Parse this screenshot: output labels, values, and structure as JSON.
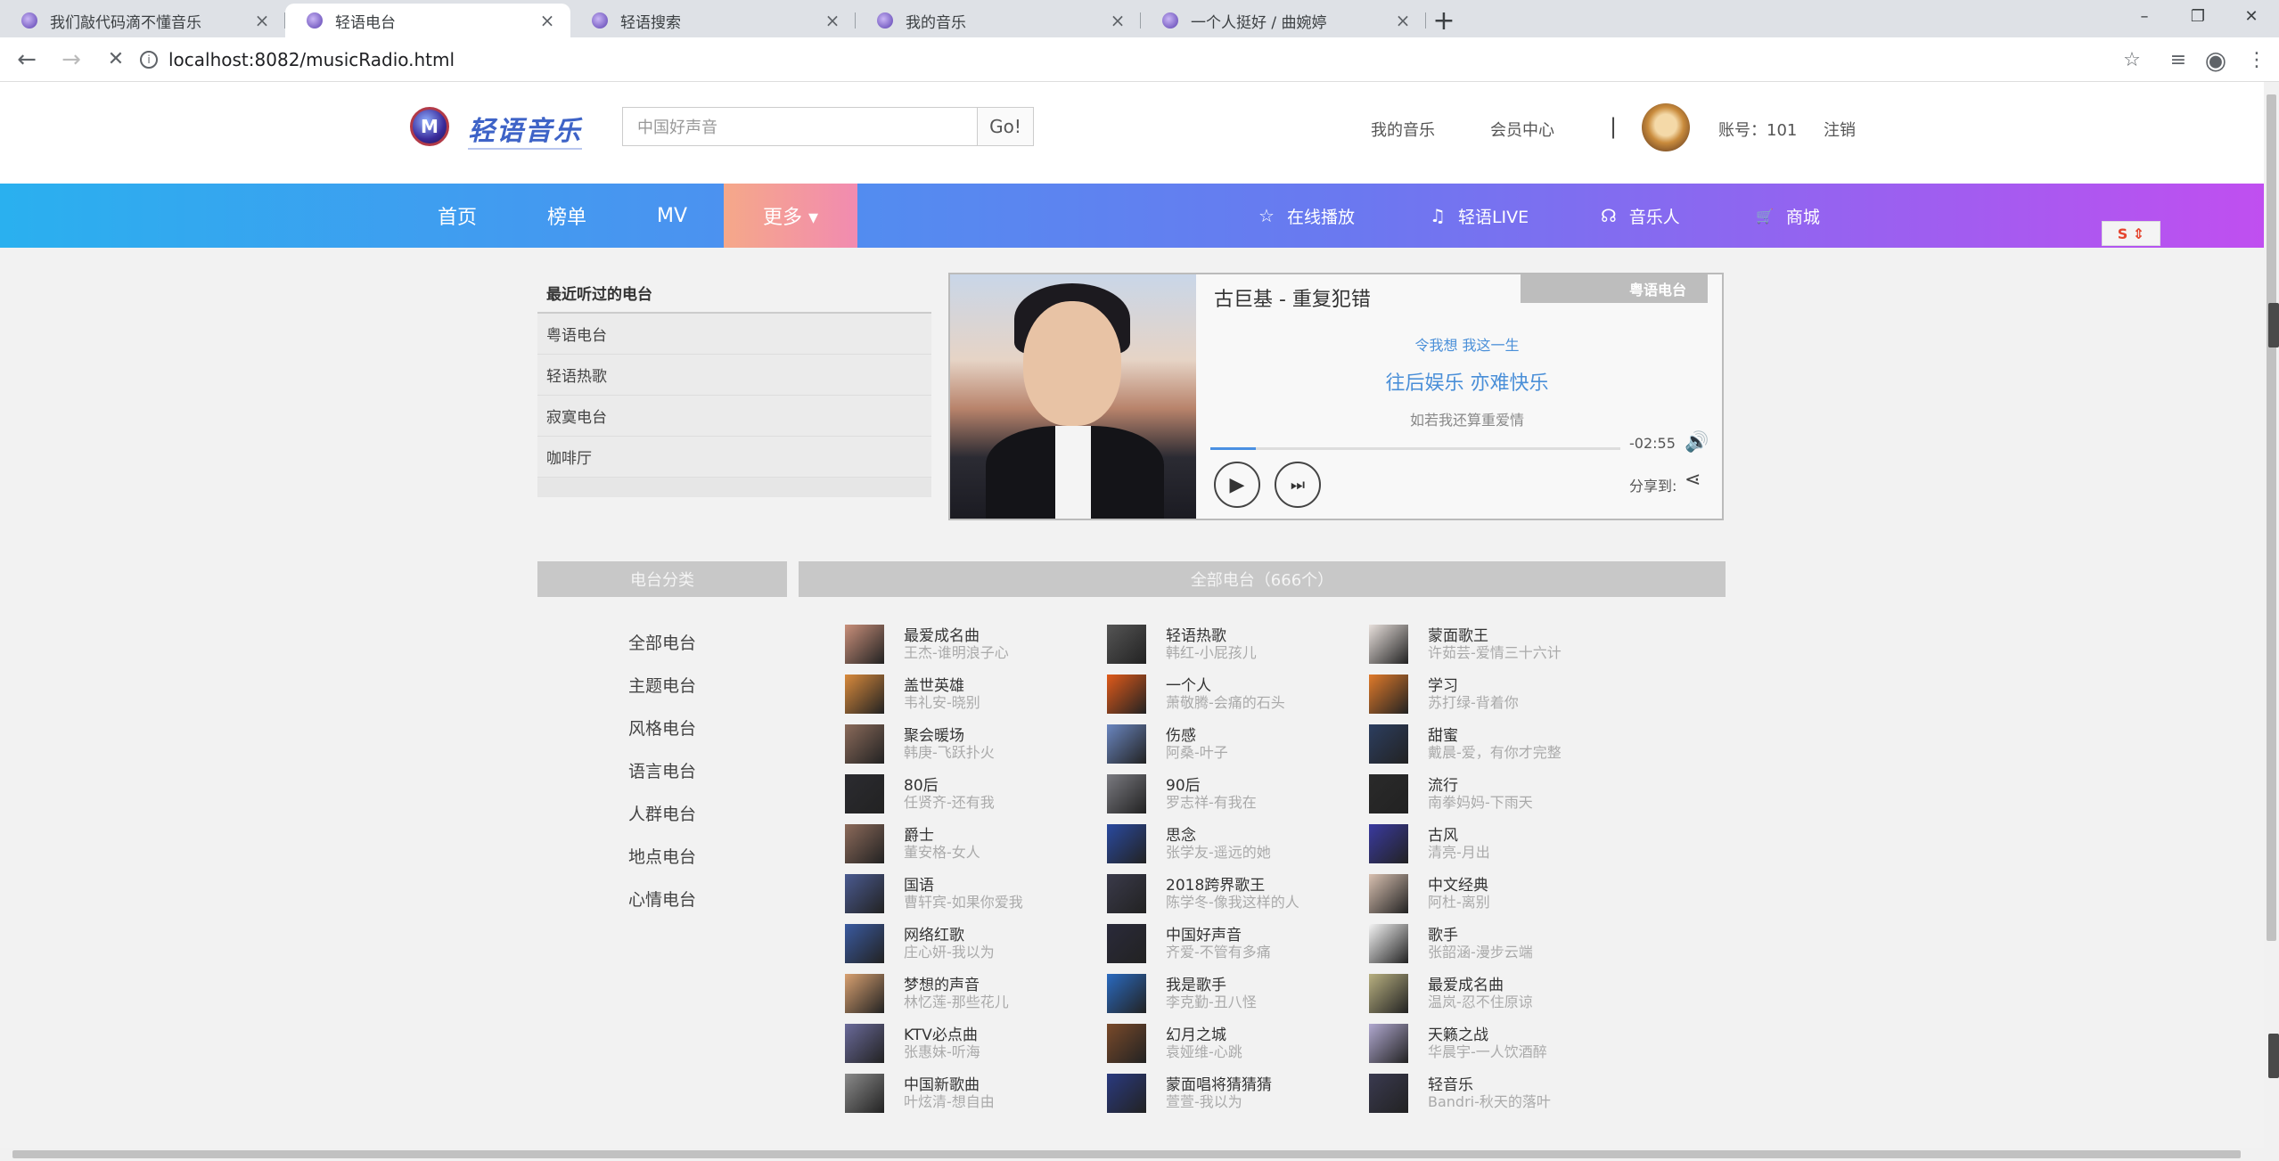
{
  "browser": {
    "tabs": [
      {
        "title": "我们敲代码滴不懂音乐",
        "active": false
      },
      {
        "title": "轻语电台",
        "active": true
      },
      {
        "title": "轻语搜索",
        "active": false
      },
      {
        "title": "我的音乐",
        "active": false
      },
      {
        "title": "一个人挺好 / 曲婉婷",
        "active": false
      }
    ],
    "close_glyph": "×",
    "new_tab_glyph": "+",
    "url": "localhost:8082/musicRadio.html",
    "back_glyph": "←",
    "forward_glyph": "→",
    "reload_glyph": "✕",
    "star_glyph": "☆",
    "minimize_glyph": "–",
    "restore_glyph": "❐",
    "close_window_glyph": "✕",
    "menu_glyph": "⋮",
    "info_glyph": "i",
    "profile_glyph": "◉",
    "queue_glyph": "≡"
  },
  "header": {
    "logo_mark": "M",
    "logo_text": "轻语音乐",
    "search_placeholder": "中国好声音",
    "go_label": "Go!",
    "links": {
      "my_music": "我的音乐",
      "member": "会员中心",
      "sep": "|",
      "account": "账号：101",
      "logout": "注销"
    }
  },
  "nav": {
    "items": [
      "首页",
      "榜单",
      "MV"
    ],
    "more": "更多 ▾",
    "right": [
      {
        "icon": "star-icon",
        "glyph": "☆",
        "label": "在线播放"
      },
      {
        "icon": "music-note-icon",
        "glyph": "♫",
        "label": "轻语LIVE"
      },
      {
        "icon": "headphones-icon",
        "glyph": "☊",
        "label": "音乐人"
      },
      {
        "icon": "cart-icon",
        "glyph": "🛒",
        "label": "商城"
      }
    ],
    "ime": "S ⇕"
  },
  "recent": {
    "title": "最近听过的电台",
    "items": [
      "粤语电台",
      "轻语热歌",
      "寂寞电台",
      "咖啡厅"
    ]
  },
  "player": {
    "song": "古巨基 - 重复犯错",
    "station": "粤语电台",
    "lyrics": [
      "令我想  我这一生",
      "往后娱乐  亦难快乐",
      "如若我还算重爱情"
    ],
    "time": "-02:55",
    "progress": 0.11,
    "play_glyph": "▶",
    "next_glyph": "⏭",
    "volume_glyph": "🔊",
    "share_label": "分享到:",
    "share_glyph": "⋖"
  },
  "categories": {
    "title": "电台分类",
    "items": [
      "全部电台",
      "主题电台",
      "风格电台",
      "语言电台",
      "人群电台",
      "地点电台",
      "心情电台"
    ]
  },
  "stations": {
    "title": "全部电台（666个）",
    "items": [
      {
        "name": "最爱成名曲",
        "sub": "王杰-谁明浪子心",
        "color": "#c98f7a"
      },
      {
        "name": "轻语热歌",
        "sub": "韩红-小屁孩儿",
        "color": "#555"
      },
      {
        "name": "蒙面歌王",
        "sub": "许茹芸-爱情三十六计",
        "color": "#e8e0dc"
      },
      {
        "name": "盖世英雄",
        "sub": "韦礼安-晓别",
        "color": "#d98a3c"
      },
      {
        "name": "一个人",
        "sub": "萧敬腾-会痛的石头",
        "color": "#e05a1a"
      },
      {
        "name": "学习",
        "sub": "苏打绿-背着你",
        "color": "#e07a2a"
      },
      {
        "name": "聚会暖场",
        "sub": "韩庚-飞跃扑火",
        "color": "#8a6a5a"
      },
      {
        "name": "伤感",
        "sub": "阿桑-叶子",
        "color": "#6a86c0"
      },
      {
        "name": "甜蜜",
        "sub": "戴晨-爱，有你才完整",
        "color": "#2c3e60"
      },
      {
        "name": "80后",
        "sub": "任贤齐-还有我",
        "color": "#2b2b30"
      },
      {
        "name": "90后",
        "sub": "罗志祥-有我在",
        "color": "#7a7a80"
      },
      {
        "name": "流行",
        "sub": "南拳妈妈-下雨天",
        "color": "#2a2a2a"
      },
      {
        "name": "爵士",
        "sub": "董安格-女人",
        "color": "#8c6a5a"
      },
      {
        "name": "思念",
        "sub": "张学友-遥远的她",
        "color": "#2a4aa0"
      },
      {
        "name": "古风",
        "sub": "清亮-月出",
        "color": "#3a3aa0"
      },
      {
        "name": "国语",
        "sub": "曹轩宾-如果你爱我",
        "color": "#4a5a90"
      },
      {
        "name": "2018跨界歌王",
        "sub": "陈学冬-像我这样的人",
        "color": "#3a3a4a"
      },
      {
        "name": "中文经典",
        "sub": "阿杜-离别",
        "color": "#d8c0b0"
      },
      {
        "name": "网络红歌",
        "sub": "庄心妍-我以为",
        "color": "#3a5aa0"
      },
      {
        "name": "中国好声音",
        "sub": "齐爱-不管有多痛",
        "color": "#2a2a3a"
      },
      {
        "name": "歌手",
        "sub": "张韶涵-漫步云端",
        "color": "#f4f4f4"
      },
      {
        "name": "梦想的声音",
        "sub": "林忆莲-那些花儿",
        "color": "#d8a070"
      },
      {
        "name": "我是歌手",
        "sub": "李克勤-丑八怪",
        "color": "#2a6ac0"
      },
      {
        "name": "最爱成名曲",
        "sub": "温岚-忍不住原谅",
        "color": "#b8b080"
      },
      {
        "name": "KTV必点曲",
        "sub": "张惠妹-听海",
        "color": "#6a6a9a"
      },
      {
        "name": "幻月之城",
        "sub": "袁娅维-心跳",
        "color": "#7a4a2a"
      },
      {
        "name": "天籁之战",
        "sub": "华晨宇-一人饮酒醉",
        "color": "#b0a8d0"
      },
      {
        "name": "中国新歌曲",
        "sub": "叶炫清-想自由",
        "color": "#8a8a8a"
      },
      {
        "name": "蒙面唱将猜猜猜",
        "sub": "萱萱-我以为",
        "color": "#2a3a80"
      },
      {
        "name": "轻音乐",
        "sub": "Bandri-秋天的落叶",
        "color": "#3a3a50"
      }
    ]
  }
}
